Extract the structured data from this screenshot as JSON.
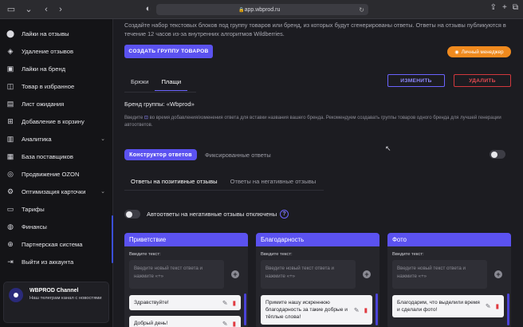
{
  "browser": {
    "url": "app.wbprod.ru"
  },
  "sidebar": {
    "items": [
      {
        "label": "Лайки на отзывы",
        "icon": "badge-icon",
        "has_chevron": false
      },
      {
        "label": "Удаление отзывов",
        "icon": "megaphone-icon",
        "has_chevron": false
      },
      {
        "label": "Лайки на бренд",
        "icon": "tag-icon",
        "has_chevron": false
      },
      {
        "label": "Товар в избранное",
        "icon": "bag-icon",
        "has_chevron": false
      },
      {
        "label": "Лист ожидания",
        "icon": "clipboard-icon",
        "has_chevron": false
      },
      {
        "label": "Добавление в корзину",
        "icon": "cart-icon",
        "has_chevron": false
      },
      {
        "label": "Аналитика",
        "icon": "chart-icon",
        "has_chevron": true
      },
      {
        "label": "База поставщиков",
        "icon": "database-icon",
        "has_chevron": false
      },
      {
        "label": "Продвижение OZON",
        "icon": "ozon-icon",
        "has_chevron": false
      },
      {
        "label": "Оптимизация карточки",
        "icon": "gear-icon",
        "has_chevron": true
      },
      {
        "label": "Тарифы",
        "icon": "wallet-icon",
        "has_chevron": false
      },
      {
        "label": "Финансы",
        "icon": "coins-icon",
        "has_chevron": false
      },
      {
        "label": "Партнерская система",
        "icon": "user-plus-icon",
        "has_chevron": false
      },
      {
        "label": "Выйти из аккаунта",
        "icon": "logout-icon",
        "has_chevron": false
      }
    ],
    "channel": {
      "title": "WBPROD Channel",
      "subtitle": "Наш телеграм канал с новостями"
    }
  },
  "main": {
    "intro_text": "Создайте набор текстовых блоков под группу товаров или бренд, из которых будут сгенерированы ответы. Ответы на отзывы публикуются в течение 12 часов из-за внутренних алгоритмов Wildberries.",
    "create_group_label": "СОЗДАТЬ ГРУППУ ТОВАРОВ",
    "manager_label": "Личный менеджер",
    "brand_tabs": [
      "Брюки",
      "Плащи"
    ],
    "active_brand_tab": 1,
    "edit_label": "ИЗМЕНИТЬ",
    "delete_label": "УДАЛИТЬ",
    "group_name": "Бренд группы: «Wbprod»",
    "hint_before": "Введите",
    "hint_after": "во время добавления/изменения ответа для вставки названия вашего бренда. Рекомендуем создавать группы товаров одного бренда для лучшей генерации автоответов.",
    "mode_tabs": {
      "constructor": "Конструктор ответов",
      "fixed": "Фиксированные ответы"
    },
    "review_tabs": [
      "Ответы на позитивные отзывы",
      "Ответы на негативные отзывы"
    ],
    "auto_label": "Автоответы на негативные отзывы отключены",
    "cards": [
      {
        "title": "Приветствие",
        "input_label": "Введите текст:",
        "placeholder": "Введите новый текст ответа и нажмите «+»",
        "responses": [
          "Здравствуйте!",
          "Добрый день!"
        ]
      },
      {
        "title": "Благодарность",
        "input_label": "Введите текст:",
        "placeholder": "Введите новый текст ответа и нажмите «+»",
        "responses": [
          "Примите нашу искреннюю благодарность за такие добрые и тёплые слова!"
        ]
      },
      {
        "title": "Фото",
        "input_label": "Введите текст:",
        "placeholder": "Введите новый текст ответа и нажмите «+»",
        "responses": [
          "Благодарим, что выделили время и сделали фото!"
        ]
      }
    ]
  },
  "colors": {
    "accent": "#5b52f0",
    "orange": "#f08a1e",
    "danger": "#e84c52"
  }
}
